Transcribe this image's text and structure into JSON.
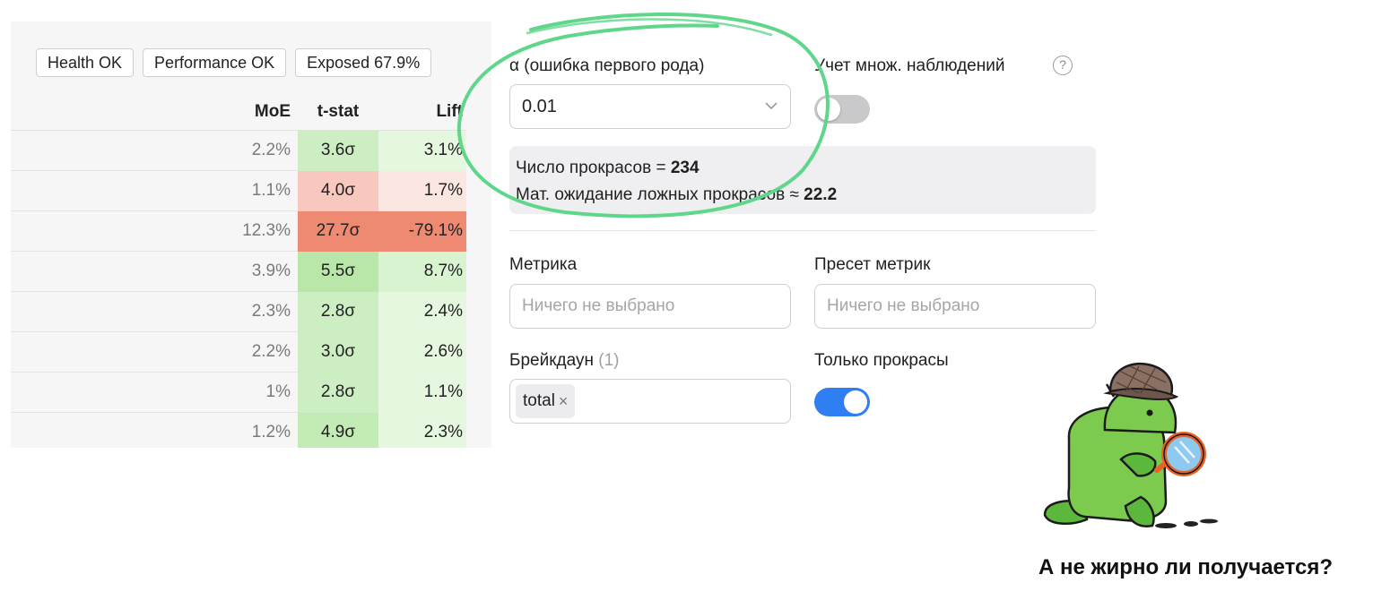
{
  "badges": [
    {
      "label": "Health  OK"
    },
    {
      "label": "Performance OK"
    },
    {
      "label": "Exposed 67.9%"
    }
  ],
  "table": {
    "headers": {
      "moe": "MoE",
      "tstat": "t-stat",
      "lift": "Lift"
    },
    "rows": [
      {
        "moe": "2.2%",
        "tstat": "3.6σ",
        "lift": "3.1%",
        "t_bg": "#cdeec3",
        "lift_bg": "#e6f7df"
      },
      {
        "moe": "1.1%",
        "tstat": "4.0σ",
        "lift": "1.7%",
        "t_bg": "#f8c7bd",
        "lift_bg": "#fce6e1"
      },
      {
        "moe": "12.3%",
        "tstat": "27.7σ",
        "lift": "-79.1%",
        "t_bg": "#ee8a72",
        "lift_bg": "#ee8a72"
      },
      {
        "moe": "3.9%",
        "tstat": "5.5σ",
        "lift": "8.7%",
        "t_bg": "#b8e7a9",
        "lift_bg": "#d8f3cf"
      },
      {
        "moe": "2.3%",
        "tstat": "2.8σ",
        "lift": "2.4%",
        "t_bg": "#cdeec3",
        "lift_bg": "#e6f7df"
      },
      {
        "moe": "2.2%",
        "tstat": "3.0σ",
        "lift": "2.6%",
        "t_bg": "#cdeec3",
        "lift_bg": "#e6f7df"
      },
      {
        "moe": "1%",
        "tstat": "2.8σ",
        "lift": "1.1%",
        "t_bg": "#cdeec3",
        "lift_bg": "#e6f7df"
      },
      {
        "moe": "1.2%",
        "tstat": "4.9σ",
        "lift": "2.3%",
        "t_bg": "#c2ebb5",
        "lift_bg": "#e6f7df"
      }
    ]
  },
  "settings": {
    "alpha_label": "α (ошибка первого рода)",
    "alpha_value": "0.01",
    "multi_label": "Учет множ. наблюдений",
    "multi_enabled": false,
    "info_count_prefix": "Число прокрасов = ",
    "info_count_value": "234",
    "info_expect_prefix": "Мат. ожидание ложных прокрасов ≈ ",
    "info_expect_value": "22.2",
    "metric_label": "Метрика",
    "metric_placeholder": "Ничего не выбрано",
    "preset_label": "Пресет метрик",
    "preset_placeholder": "Ничего не выбрано",
    "breakdown_label": "Брейкдаун",
    "breakdown_count": "(1)",
    "breakdown_chip": "total",
    "only_label": "Только прокрасы",
    "only_enabled": true
  },
  "annotation_color": "#5fd68a",
  "toggle_on_color": "#2f7ff2",
  "caption": "А не жирно ли получается?"
}
